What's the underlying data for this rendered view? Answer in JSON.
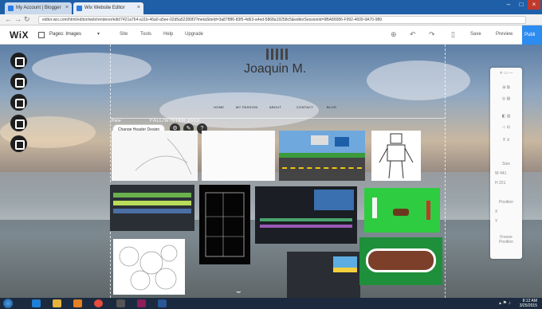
{
  "browser": {
    "tabs": [
      {
        "label": "My Account | Blogger"
      },
      {
        "label": "Wix Website Editor"
      }
    ],
    "url": "editor.wix.com/html/editor/web/renderer/edit/7421a764-a11b-46a0-a5ee-02d5a52289f3?metaSiteId=3a87f8f6-83f5-4d63-a4ed-5868a19258c5&editorSessionId=9BA80086-F992-4609-9A70-989"
  },
  "editor": {
    "logo": "WiX",
    "pages_label": "Pages: Images",
    "menu": [
      "Site",
      "Tools",
      "Help",
      "Upgrade"
    ],
    "save": "Save",
    "preview": "Preview",
    "publish": "Publi"
  },
  "site": {
    "name": "Joaquin M.",
    "nav": [
      "HOME",
      "MY PASSION",
      "ABOUT",
      "CONTACT",
      "BLOG"
    ],
    "season": "FALL/WINTER 2013",
    "panel_tag": "Pane",
    "change_header": "Change Header Design"
  },
  "right_panel": {
    "labels": [
      "Size",
      "W",
      "H",
      "Position",
      "X",
      "Y",
      "Freeze Position"
    ],
    "w_value": "441",
    "h_value": "221"
  },
  "taskbar": {
    "time": "8:12 AM",
    "date": "3/25/2015"
  },
  "colors": {
    "tab_strip": "#1f5fa8",
    "publish": "#2d8cf0",
    "taskbar": "#1b2a3f"
  }
}
